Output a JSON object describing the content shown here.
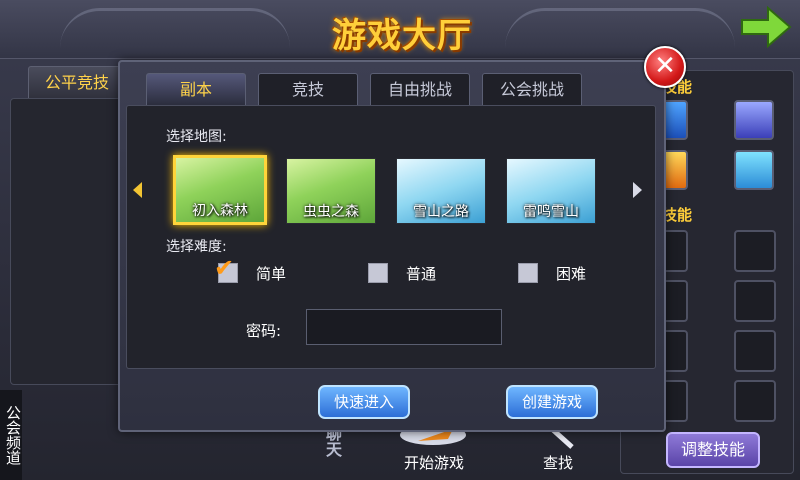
{
  "header": {
    "title": "游戏大厅"
  },
  "left": {
    "tab_label": "公平竞技",
    "guild_channel": "公会频道",
    "chat_label": "聊天"
  },
  "bottom": {
    "start_game": "开始游戏",
    "search": "查找"
  },
  "right": {
    "skills_label": "技能",
    "skills_label2": "技能",
    "adjust_skills": "调整技能"
  },
  "dialog": {
    "tabs": [
      {
        "label": "副本",
        "active": true
      },
      {
        "label": "竞技",
        "active": false
      },
      {
        "label": "自由挑战",
        "active": false
      },
      {
        "label": "公会挑战",
        "active": false
      }
    ],
    "select_map_label": "选择地图:",
    "maps": [
      {
        "label": "初入森林",
        "selected": true
      },
      {
        "label": "虫虫之森",
        "selected": false
      },
      {
        "label": "雪山之路",
        "selected": false
      },
      {
        "label": "雷鸣雪山",
        "selected": false
      }
    ],
    "select_difficulty_label": "选择难度:",
    "difficulties": [
      {
        "label": "简单",
        "checked": true
      },
      {
        "label": "普通",
        "checked": false
      },
      {
        "label": "困难",
        "checked": false
      }
    ],
    "password_label": "密码:",
    "password_value": "",
    "quick_enter": "快速进入",
    "create_game": "创建游戏"
  },
  "colors": {
    "accent": "#ffd34a",
    "button": "#2c6ed6",
    "close": "#d31818"
  }
}
